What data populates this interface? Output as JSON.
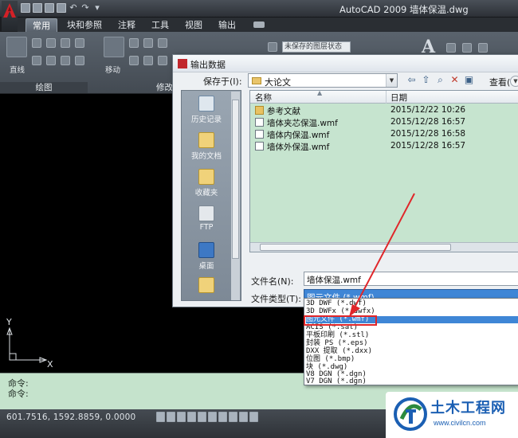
{
  "window": {
    "title": "AutoCAD 2009  墙体保温.dwg"
  },
  "ribbon": {
    "tabs": [
      "常用",
      "块和参照",
      "注释",
      "工具",
      "视图",
      "输出"
    ],
    "active_tab": "常用",
    "draw_panel_label": "绘图",
    "modify_panel_label": "修改",
    "line_label": "直线",
    "move_label": "移动",
    "layer_state": "未保存的图层状态"
  },
  "dialog": {
    "title": "输出数据",
    "save_in_label": "保存于(I):",
    "save_in_value": "大论文",
    "view_label": "查看(V)",
    "places": [
      "历史记录",
      "我的文档",
      "收藏夹",
      "FTP",
      "桌面"
    ],
    "columns": {
      "name": "名称",
      "date": "日期"
    },
    "files": [
      {
        "name": "参考文献",
        "date": "2015/12/22 10:26",
        "kind": "folder"
      },
      {
        "name": "墙体夹芯保温.wmf",
        "date": "2015/12/28 16:57",
        "kind": "wmf"
      },
      {
        "name": "墙体内保温.wmf",
        "date": "2015/12/28 16:58",
        "kind": "wmf"
      },
      {
        "name": "墙体外保温.wmf",
        "date": "2015/12/28 16:57",
        "kind": "wmf"
      }
    ],
    "filename_label": "文件名(N):",
    "filename_value": "墙体保温.wmf",
    "filetype_label": "文件类型(T):",
    "filetype_value": "图元文件 (*.wmf)"
  },
  "filetype_options": [
    "3D DWF (*.dwf)",
    "3D DWFx (*.dwfx)",
    "图元文件 (*.wmf)",
    "ACIS (*.sat)",
    "平板印刷 (*.stl)",
    "封装 PS (*.eps)",
    "DXX 提取 (*.dxx)",
    "位图 (*.bmp)",
    "块 (*.dwg)",
    "V8 DGN (*.dgn)",
    "V7 DGN (*.dgn)"
  ],
  "ucs": {
    "x_label": "X",
    "y_label": "Y"
  },
  "command_line": {
    "line1": "命令:",
    "line2": "命令:"
  },
  "status": {
    "coordinates": "601.7516,  1592.8859, 0.0000"
  },
  "watermark": {
    "title": "土木工程网",
    "url": "www.civilcn.com"
  },
  "colors": {
    "accent_red": "#e0262a",
    "selection_blue": "#3f86d6",
    "list_background": "#c6e4cf"
  }
}
